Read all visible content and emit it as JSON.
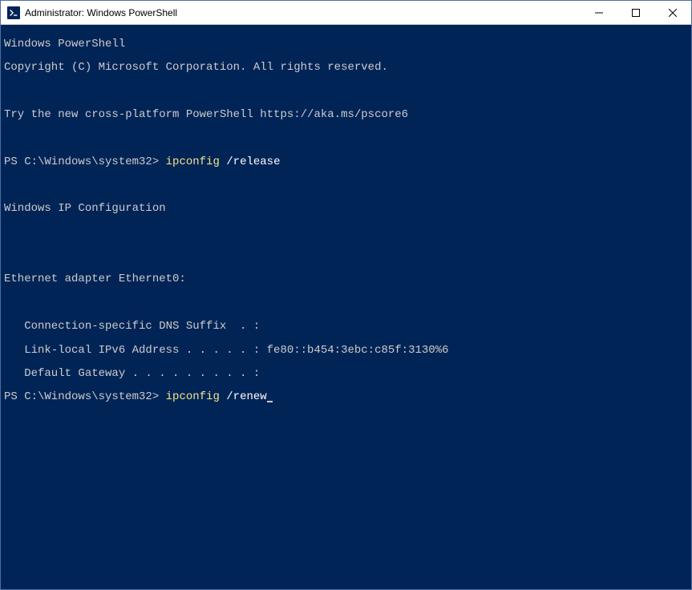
{
  "window": {
    "title": "Administrator: Windows PowerShell"
  },
  "terminal": {
    "line1": "Windows PowerShell",
    "line2": "Copyright (C) Microsoft Corporation. All rights reserved.",
    "line3": "Try the new cross-platform PowerShell https://aka.ms/pscore6",
    "prompt1_path": "PS C:\\Windows\\system32> ",
    "prompt1_cmd": "ipconfig",
    "prompt1_arg": " /release",
    "line5": "Windows IP Configuration",
    "line6": "Ethernet adapter Ethernet0:",
    "line7": "   Connection-specific DNS Suffix  . :",
    "line8": "   Link-local IPv6 Address . . . . . : fe80::b454:3ebc:c85f:3130%6",
    "line9": "   Default Gateway . . . . . . . . . :",
    "prompt2_path": "PS C:\\Windows\\system32> ",
    "prompt2_cmd": "ipconfig",
    "prompt2_arg": " /renew"
  }
}
